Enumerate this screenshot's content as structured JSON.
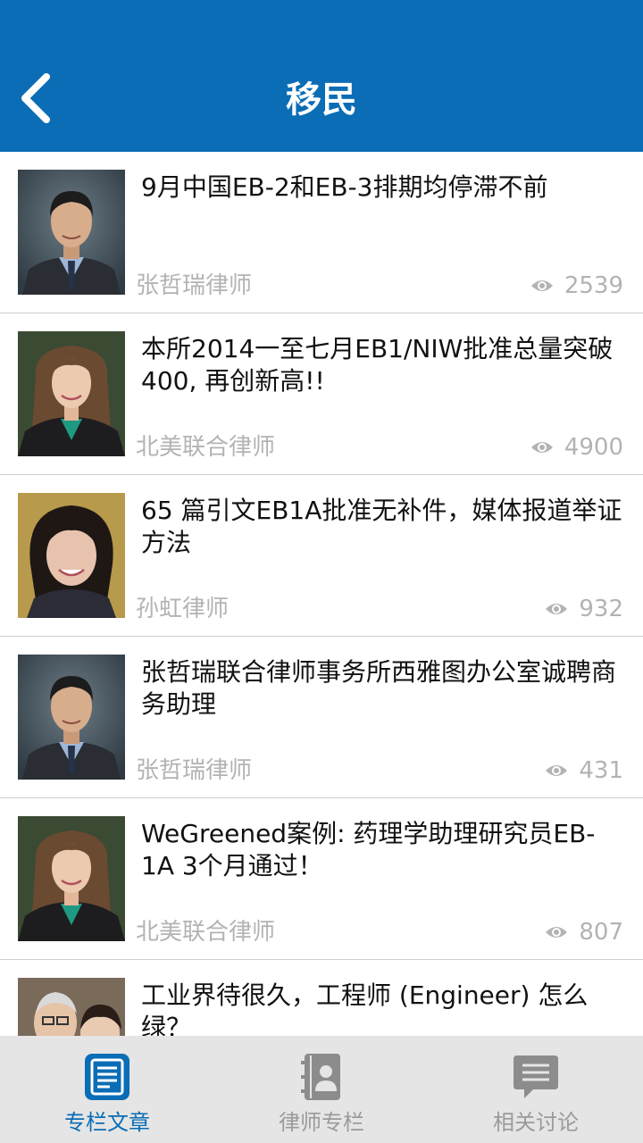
{
  "header": {
    "title": "移民"
  },
  "articles": [
    {
      "title": "9月中国EB-2和EB-3排期均停滞不前",
      "author": "张哲瑞律师",
      "views": "2539"
    },
    {
      "title": "本所2014一至七月EB1/NIW批准总量突破400, 再创新高!!",
      "author": "北美联合律师",
      "views": "4900"
    },
    {
      "title": "65 篇引文EB1A批准无补件，媒体报道举证方法",
      "author": "孙虹律师",
      "views": "932"
    },
    {
      "title": "张哲瑞联合律师事务所西雅图办公室诚聘商务助理",
      "author": "张哲瑞律师",
      "views": "431"
    },
    {
      "title": "WeGreened案例: 药理学助理研究员EB-1A 3个月通过！",
      "author": "北美联合律师",
      "views": "807"
    },
    {
      "title": "工业界待很久，工程师 (Engineer) 怎么绿？",
      "author": "",
      "views": ""
    }
  ],
  "tabs": [
    {
      "label": "专栏文章",
      "icon": "document-icon",
      "active": true
    },
    {
      "label": "律师专栏",
      "icon": "contact-book-icon",
      "active": false
    },
    {
      "label": "相关讨论",
      "icon": "chat-bubble-icon",
      "active": false
    }
  ],
  "colors": {
    "primary": "#0a6db5",
    "tab_bar": "#e5e5e5",
    "muted": "#b3b3b3",
    "divider": "#cfcfcf"
  }
}
